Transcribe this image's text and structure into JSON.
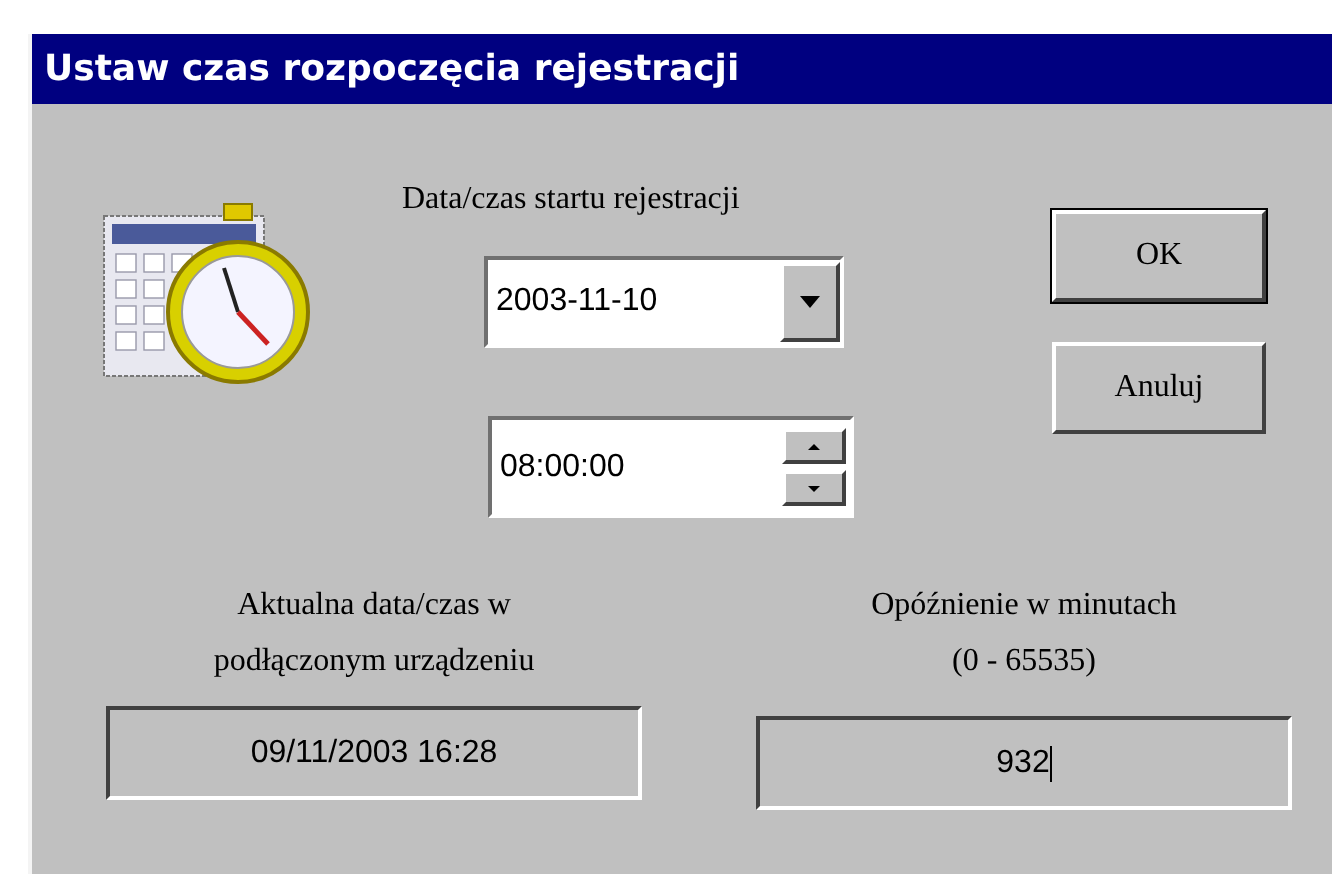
{
  "window": {
    "title": "Ustaw czas rozpoczęcia rejestracji"
  },
  "start": {
    "label": "Data/czas startu rejestracji",
    "date_field": {
      "value": "2003-11-10"
    },
    "time_field": {
      "value": "08:00:00"
    }
  },
  "buttons": [
    {
      "label": "OK",
      "kind": "default"
    },
    {
      "label": "Anuluj",
      "kind": "normal"
    }
  ],
  "device_time": {
    "label_lines": [
      "Aktualna data/czas w",
      "podłączonym urządzeniu"
    ],
    "value": "09/11/2003 16:28"
  },
  "delay": {
    "label_lines": [
      "Opóźnienie w minutach",
      "(0 - 65535)"
    ],
    "value": "932",
    "focused": true
  }
}
